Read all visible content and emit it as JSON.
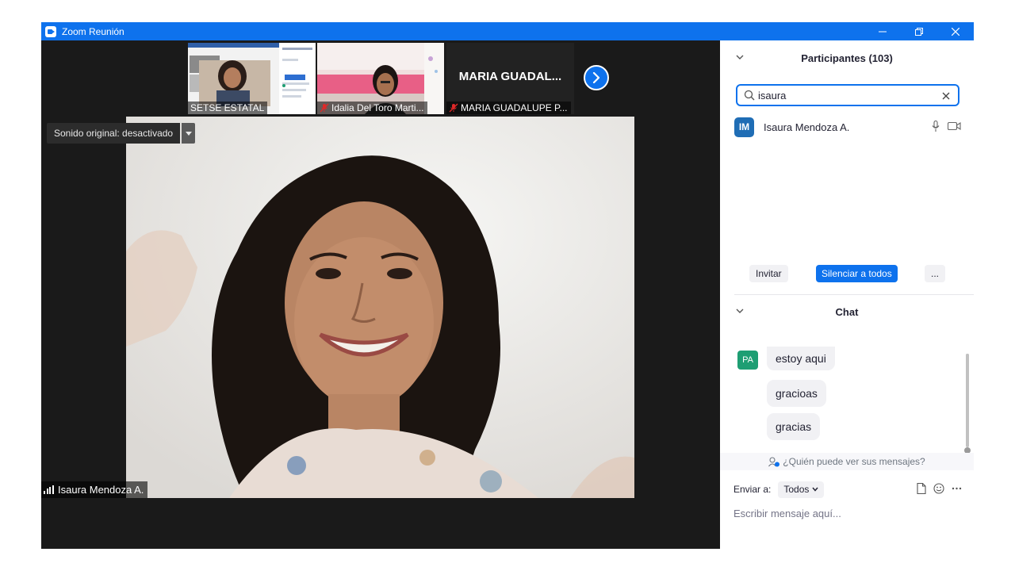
{
  "window": {
    "title": "Zoom Reunión"
  },
  "thumbnails": [
    {
      "name": "SETSE ESTATAL",
      "muted": false
    },
    {
      "name": "Idalia Del Toro Marti...",
      "muted": true
    },
    {
      "name": "MARIA GUADALUPE P...",
      "muted": true,
      "display_name": "MARIA GUADAL..."
    }
  ],
  "main_video": {
    "sound_label": "Sonido original: desactivado",
    "speaker_name": "Isaura Mendoza A."
  },
  "participants": {
    "header": "Participantes (103)",
    "search_value": "isaura",
    "items": [
      {
        "initials": "IM",
        "name": "Isaura Mendoza A."
      }
    ],
    "invite_label": "Invitar",
    "mute_all_label": "Silenciar a todos",
    "more_label": "..."
  },
  "chat": {
    "header": "Chat",
    "sender_initials": "PA",
    "messages": [
      "estoy aqui",
      "gracioas",
      "gracias"
    ],
    "who_sees": "¿Quién puede ver sus mensajes?",
    "send_to_label": "Enviar a:",
    "recipient": "Todos",
    "placeholder": "Escribir mensaje aquí..."
  },
  "colors": {
    "accent": "#0e72ed",
    "avatar_blue": "#1f6db5",
    "avatar_green": "#1e9e73",
    "muted_red": "#e02828"
  }
}
